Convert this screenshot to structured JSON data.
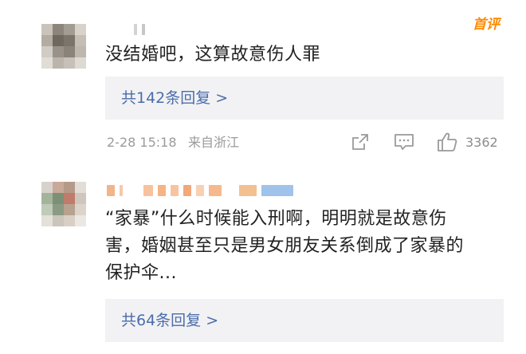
{
  "comments": [
    {
      "badge": "首评",
      "text_lines": [
        "没结婚吧，这算故意伤人罪"
      ],
      "reply_link": "共142条回复 >",
      "date": "2-28 15:18",
      "location": "来自浙江",
      "likes": "3362"
    },
    {
      "text_lines": [
        "“家暴”什么时候能入刑啊，明明就是故意伤",
        "害，婚姻甚至只是男女朋友关系倒成了家暴的",
        "保护伞..."
      ],
      "reply_link": "共64条回复 >"
    }
  ],
  "icons": {
    "share": "share-icon",
    "comment": "comment-icon",
    "like": "thumbs-up-icon"
  }
}
